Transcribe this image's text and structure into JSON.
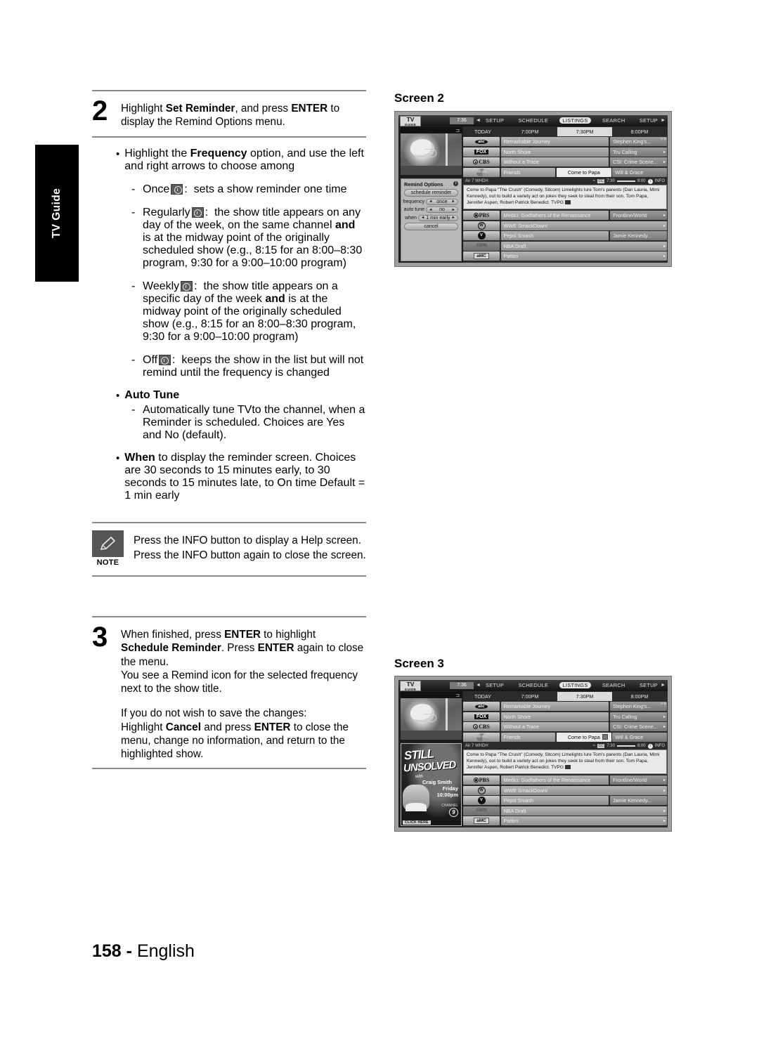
{
  "side_tab": {
    "label": "TV Guide"
  },
  "footer": {
    "page": "158 -",
    "language": "English"
  },
  "step2": {
    "number": "2",
    "line1_pre": "Highlight ",
    "line1_b1": "Set Reminder",
    "line1_mid": ", and press ",
    "line1_b2": "ENTER",
    "line1_post": " to display the Remind Options menu."
  },
  "frequency_bullet": {
    "dot": "•",
    "pre": "Highlight the ",
    "bold": "Frequency",
    "post": " option, and use the left and right arrows to choose among"
  },
  "freq_items": [
    {
      "dash": "-",
      "name": "Once",
      "icon": "alarm-clock-once-icon",
      "colon": ":",
      "text": "sets a show reminder one time"
    },
    {
      "dash": "-",
      "name": "Regularly",
      "icon": "alarm-clock-regular-icon",
      "colon": ":",
      "text_a": "the show title appears on any day of the week, on the same channel ",
      "bold": "and",
      "text_b": " is at the midway point of the originally scheduled show (e.g., 8:15 for an 8:00–8:30 program, 9:30 for a 9:00–10:00 program)"
    },
    {
      "dash": "-",
      "name": "Weekly",
      "icon": "alarm-clock-weekly-icon",
      "colon": ":",
      "text_a": "the show title appears on a specific day of the week ",
      "bold": "and",
      "text_b": " is at the midway point of the originally scheduled show (e.g., 8:15 for an 8:00–8:30 program, 9:30 for a 9:00–10:00 program)"
    },
    {
      "dash": "-",
      "name": "Off",
      "icon": "alarm-clock-off-icon",
      "colon": ":",
      "text": "keeps the show in the list but will not remind until the frequency is changed"
    }
  ],
  "auto_tune": {
    "dot": "•",
    "heading": "Auto Tune",
    "dash": "-",
    "text": "Automatically tune TVto the channel, when a Reminder is scheduled. Choices are Yes and No (default)."
  },
  "when_bullet": {
    "dot": "•",
    "bold": "When",
    "text": " to display the reminder screen. Choices are 30 seconds to 15 minutes early, to 30 seconds to 15 minutes late, to On time Default = 1 min early"
  },
  "note": {
    "label": "NOTE",
    "icon": "pencil-icon",
    "text": "Press the INFO button to display a Help screen. Press the INFO button again to close the screen."
  },
  "step3": {
    "number": "3",
    "p1_pre": "When finished, press ",
    "p1_b1": "ENTER",
    "p1_mid": " to highlight ",
    "p1_b2": "Schedule Reminder",
    "p1_mid2": ". Press ",
    "p1_b3": "ENTER",
    "p1_post": " again to close the menu.",
    "p2": "You see a Remind icon for the selected frequency next to the show title.",
    "p3": "If you do not wish to save the changes:",
    "p4_pre": "Highlight ",
    "p4_b1": "Cancel",
    "p4_mid": " and press ",
    "p4_b2": "ENTER",
    "p4_post": " to close the menu, change no information, and return to the highlighted show."
  },
  "screen2": {
    "caption": "Screen  2"
  },
  "screen3": {
    "caption": "Screen  3"
  },
  "tv": {
    "logo_line1": "TV",
    "logo_line2": "GUIDE",
    "clock": "7:36",
    "arrow_left": "◄",
    "arrow_right": "►",
    "nav": [
      {
        "label": "SETUP",
        "selected": false
      },
      {
        "label": "SCHEDULE",
        "selected": false
      },
      {
        "label": "LISTINGS",
        "selected": true
      },
      {
        "label": "SEARCH",
        "selected": false
      },
      {
        "label": "SETUP",
        "selected": false
      }
    ],
    "grid_header": [
      "TODAY",
      "7:00PM",
      "7:30PM",
      "8:00PM"
    ],
    "rows_top": [
      {
        "channel": "abc",
        "logo": "abc-logo",
        "left": "Remarkable Journey",
        "right": "Stephen King's...",
        "hd": "H D"
      },
      {
        "channel": "FOX",
        "logo": "fox-logo",
        "left": "North Shore",
        "right": "Tru Calling"
      },
      {
        "channel": "CBS",
        "logo": "cbs-logo",
        "left": "Without a Trace",
        "right": "CSI: Crime Scene..."
      },
      {
        "channel": "NBC",
        "logo": "nbc-logo",
        "left": "Friends",
        "mid": "Come to Papa",
        "right": "Will & Grace"
      }
    ],
    "info_bar": {
      "station": "Air 7 WHDH",
      "cc": "CC",
      "t_start": "7:30",
      "t_end": "8:00",
      "info": "INFO"
    },
    "description": "Come to Papa \"The Crush\" (Comedy, Sitcom) Limelights lure Tom's parents (Dan Lauria, Mimi Kennedy), out to build a variety act on jokes they seek to steal from their son. Tom Papa, Jennifer Aspen, Robert Patrick Benedict. TVPG",
    "rows_bottom": [
      {
        "channel": "PBS",
        "logo": "pbs-logo",
        "left": "Medici: Godfathers of the Renaissance",
        "right": "Frontline/World"
      },
      {
        "channel": "WWE",
        "logo": "wwe-logo",
        "left": "WWE SmackDown!",
        "right": ""
      },
      {
        "channel": "VH1",
        "logo": "vh1-logo",
        "left": "Pepsi Smash",
        "right": "Jamie Kennedy..."
      },
      {
        "channel": "ESPN",
        "logo": "espn-logo",
        "left": "NBA Draft",
        "right": ""
      },
      {
        "channel": "aMC",
        "logo": "amc-logo",
        "left": "Patton",
        "right": ""
      }
    ],
    "remind_options": {
      "title": "Remind Options",
      "info_icon": "i",
      "schedule_button": "schedule reminder",
      "fields": [
        {
          "label": "frequency",
          "value": "once"
        },
        {
          "label": "auto tune",
          "value": "no"
        },
        {
          "label": "when",
          "value": "1 min early"
        }
      ],
      "cancel_button": "cancel"
    },
    "ad": {
      "title_line1": "STILL",
      "title_line2": "UNSOLVED",
      "with": "with",
      "host": "Craig Smith",
      "day": "Friday",
      "time": "10:00pm",
      "channel_word": "CHANNEL",
      "channel_num": "9",
      "click": "CLICK HERE"
    }
  }
}
